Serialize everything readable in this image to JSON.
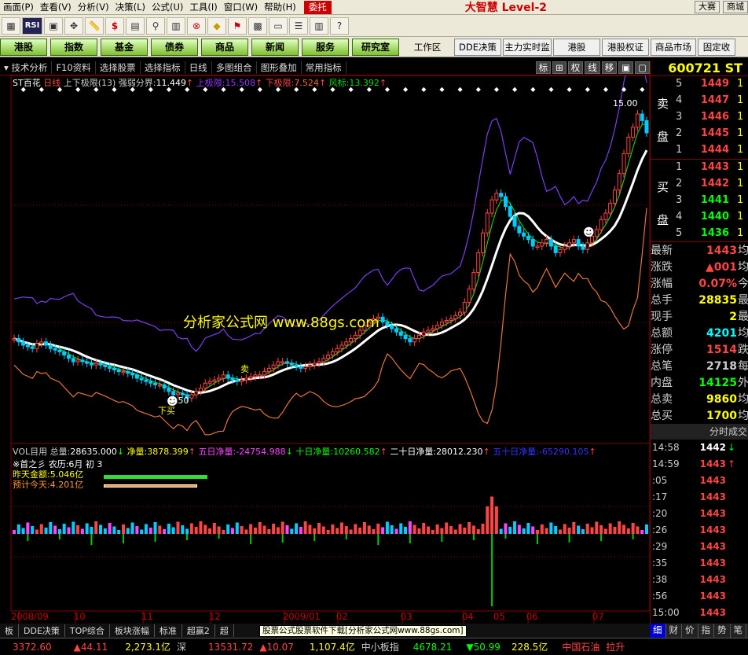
{
  "menu": [
    "画面(P)",
    "查看(V)",
    "分析(V)",
    "决策(L)",
    "公式(U)",
    "工具(I)",
    "窗口(W)",
    "帮助(H)"
  ],
  "menu_trade": "委托",
  "brand": "大智慧 Level-2",
  "menu_right": [
    "大赛",
    "商城"
  ],
  "big_buttons": [
    "港股",
    "指数",
    "基金",
    "债券",
    "商品",
    "新闻",
    "服务",
    "研究室"
  ],
  "work_area": "工作区",
  "white_buttons": [
    "DDE决策",
    "主力实时监",
    "港股",
    "港股权证",
    "商品市场",
    "固定收"
  ],
  "toolbar": [
    "技术分析",
    "F10资料",
    "选择股票",
    "选择指标",
    "日线",
    "多图组合",
    "图形叠加",
    "常用指标"
  ],
  "toolbar_right": [
    "标",
    "权",
    "线",
    "移"
  ],
  "indicator": {
    "name": "ST百花",
    "period": "日线",
    "ind": "上下极限(13)",
    "strong": "强弱分界:",
    "strong_val": "11.449",
    "up": "上极限:",
    "up_val": "15.508",
    "down": "下极限:",
    "down_val": "7.524",
    "risk": "风标:",
    "risk_val": "13.392"
  },
  "labels": {
    "high": "15.00",
    "low": "7.50",
    "buy": "买",
    "sell": "卖",
    "lower_buy": "下买"
  },
  "watermark": "分析家公式网 www.88gs.com",
  "vol": {
    "title": "VOL目用",
    "total": "总量:",
    "total_val": "28635.000",
    "net": "净量:",
    "net_val": "3878.399",
    "f5": "五日净量:",
    "f5_val": "-24754.988",
    "f10": "十日净量:",
    "f10_val": "10260.582",
    "f20": "二十日净量:",
    "f20_val": "28012.230",
    "f50": "五十日净量:",
    "f50_val": "-65290.105"
  },
  "vol_info": {
    "l1": "※首之彡  农历:6月 初 3",
    "l2": "昨天金额:5.046亿",
    "l3": "预计今天:4.201亿"
  },
  "dates": [
    "2008/09",
    "10",
    "11",
    "12",
    "2009/01",
    "02",
    "03",
    "04",
    "05",
    "06",
    "07"
  ],
  "bottom_tabs": [
    "板",
    "DDE决策",
    "TOP综合",
    "板块涨幅",
    "标准",
    "超赢2",
    "超"
  ],
  "tip": "股票公式股票软件下载[分析家公式网www.88gs.com]",
  "status": [
    "3372.60",
    "▲44.11",
    "2,273.1亿",
    "深",
    "13531.72",
    "▲10.07",
    "1,107.4亿",
    "中小板指",
    "4678.21",
    "▼50.99",
    "228.5亿"
  ],
  "right": {
    "code": "600721",
    "code_suffix": "ST",
    "sell_label": [
      "卖",
      "盘"
    ],
    "buy_label": [
      "买",
      "盘"
    ],
    "sell": [
      {
        "n": "5",
        "p": "1449",
        "v": "1"
      },
      {
        "n": "4",
        "p": "1447",
        "v": "1"
      },
      {
        "n": "3",
        "p": "1446",
        "v": "1"
      },
      {
        "n": "2",
        "p": "1445",
        "v": "1"
      },
      {
        "n": "1",
        "p": "1444",
        "v": "1"
      }
    ],
    "buy": [
      {
        "n": "1",
        "p": "1443",
        "v": "1"
      },
      {
        "n": "2",
        "p": "1442",
        "v": "1"
      },
      {
        "n": "3",
        "p": "1441",
        "v": "1"
      },
      {
        "n": "4",
        "p": "1440",
        "v": "1"
      },
      {
        "n": "5",
        "p": "1436",
        "v": "1"
      }
    ],
    "quote": [
      {
        "k": "最新",
        "v": "1443",
        "c": "#f44",
        "x": "均"
      },
      {
        "k": "涨跌",
        "v": "▲001",
        "c": "#f44",
        "x": "均"
      },
      {
        "k": "涨幅",
        "v": "0.07%",
        "c": "#f44",
        "x": "今"
      },
      {
        "k": "总手",
        "v": "28835",
        "c": "#ff0",
        "x": "最"
      },
      {
        "k": "现手",
        "v": "2",
        "c": "#ff0",
        "x": "最"
      },
      {
        "k": "总额",
        "v": "4201",
        "c": "#0ff",
        "x": "均"
      },
      {
        "k": "涨停",
        "v": "1514",
        "c": "#f44",
        "x": "跌"
      },
      {
        "k": "总笔",
        "v": "2718",
        "c": "#ccc",
        "x": "每"
      },
      {
        "k": "内盘",
        "v": "14125",
        "c": "#0f0",
        "x": "外"
      },
      {
        "k": "总卖",
        "v": "9860",
        "c": "#ff0",
        "x": "均"
      },
      {
        "k": "总买",
        "v": "1700",
        "c": "#ff0",
        "x": "均"
      }
    ],
    "ticks_title": "分时成交",
    "ticks": [
      {
        "t": "14:58",
        "p": "1442",
        "c": "#fff",
        "a": "↓"
      },
      {
        "t": "14:59",
        "p": "1443",
        "c": "#f44",
        "a": "↑"
      },
      {
        "t": ":05",
        "p": "1443",
        "c": "#f44",
        "a": ""
      },
      {
        "t": ":17",
        "p": "1443",
        "c": "#f44",
        "a": ""
      },
      {
        "t": ":20",
        "p": "1443",
        "c": "#f44",
        "a": ""
      },
      {
        "t": ":26",
        "p": "1443",
        "c": "#f44",
        "a": ""
      },
      {
        "t": ":29",
        "p": "1443",
        "c": "#f44",
        "a": ""
      },
      {
        "t": ":35",
        "p": "1443",
        "c": "#f44",
        "a": ""
      },
      {
        "t": ":38",
        "p": "1443",
        "c": "#f44",
        "a": ""
      },
      {
        "t": ":56",
        "p": "1443",
        "c": "#f44",
        "a": ""
      },
      {
        "t": "15:00",
        "p": "1443",
        "c": "#f44",
        "a": ""
      }
    ],
    "bottom_tabs": [
      "细",
      "财",
      "价",
      "指",
      "势",
      "笔"
    ],
    "status_right": [
      "中国石油",
      "拉升"
    ]
  },
  "chart_data": {
    "type": "candlestick",
    "price_axis_marks": [
      10,
      11.5,
      13,
      14.5
    ],
    "annotations": [
      "15.00",
      "7.50"
    ],
    "date_ticks": [
      "2008/09",
      "10",
      "11",
      "12",
      "2009/01",
      "02",
      "03",
      "04",
      "05",
      "06",
      "07"
    ],
    "closes": [
      8.2,
      8.1,
      8.0,
      7.95,
      7.9,
      8.05,
      8.1,
      8.0,
      7.9,
      7.85,
      7.8,
      7.7,
      7.6,
      7.5,
      7.55,
      7.5,
      7.45,
      7.4,
      7.45,
      7.4,
      7.35,
      7.3,
      7.25,
      7.2,
      7.2,
      7.15,
      7.1,
      7.0,
      6.95,
      6.9,
      6.85,
      6.8,
      6.8,
      6.7,
      6.6,
      6.5,
      6.55,
      6.5,
      6.4,
      6.5,
      6.6,
      6.7,
      6.85,
      6.9,
      6.95,
      7.0,
      7.1,
      7.0,
      6.95,
      6.9,
      6.95,
      7.0,
      7.05,
      7.1,
      7.1,
      7.2,
      7.3,
      7.4,
      7.5,
      7.5,
      7.45,
      7.4,
      7.35,
      7.3,
      7.35,
      7.4,
      7.45,
      7.5,
      7.6,
      7.7,
      7.8,
      7.9,
      8.0,
      8.1,
      8.2,
      8.3,
      8.45,
      8.6,
      8.7,
      8.8,
      8.85,
      8.7,
      8.6,
      8.5,
      8.4,
      8.3,
      8.2,
      8.1,
      8.2,
      8.3,
      8.4,
      8.45,
      8.5,
      8.6,
      8.7,
      8.75,
      8.8,
      8.9,
      9.0,
      9.3,
      9.7,
      10.2,
      10.8,
      11.4,
      12.0,
      12.4,
      12.6,
      12.5,
      12.2,
      11.9,
      11.6,
      11.4,
      11.3,
      11.2,
      11.0,
      11.0,
      11.1,
      11.2,
      11.0,
      10.8,
      10.9,
      11.0,
      11.1,
      11.2,
      11.0,
      10.9,
      11.1,
      11.3,
      11.5,
      11.8,
      12.0,
      12.3,
      12.7,
      13.2,
      13.8,
      14.3,
      14.6,
      15.0,
      14.8,
      14.43
    ]
  }
}
